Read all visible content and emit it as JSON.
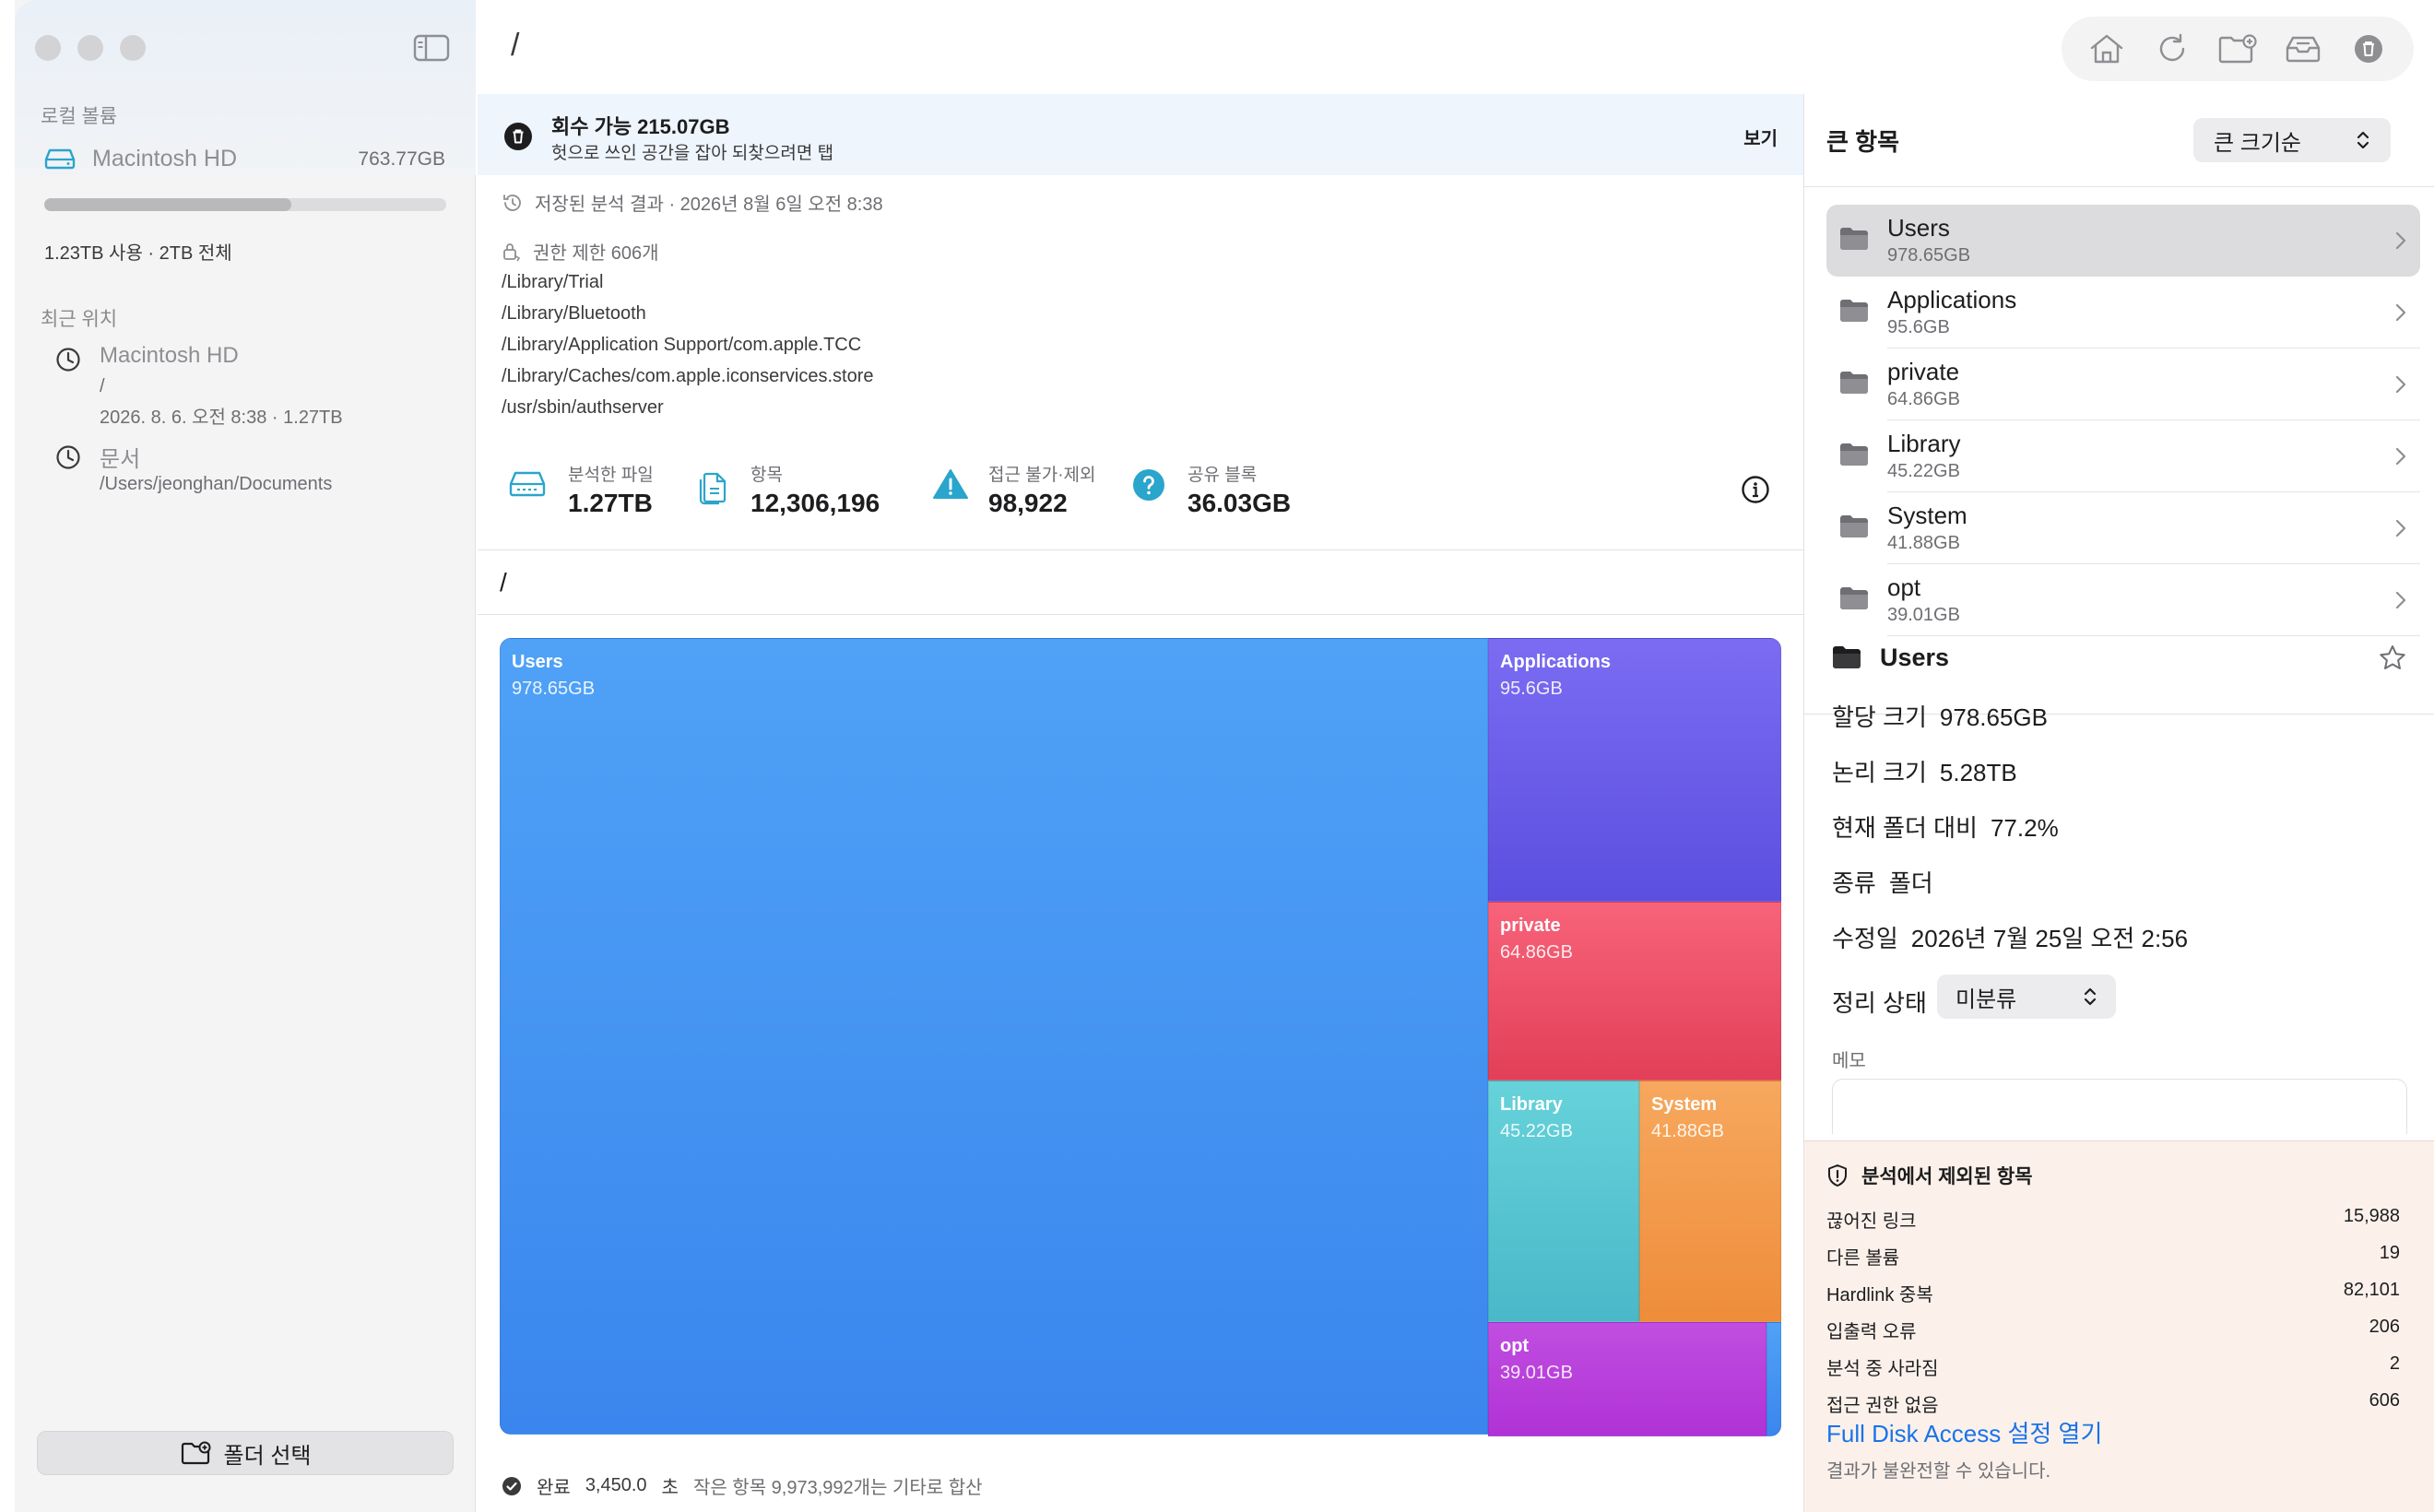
{
  "sidebar": {
    "local_volumes_title": "로컬 볼륨",
    "volume": {
      "name": "Macintosh HD",
      "free": "763.77GB",
      "usage_text": "1.23TB 사용 · 2TB 전체",
      "used_fraction": 0.615
    },
    "recent_title": "최근 위치",
    "recents": [
      {
        "title": "Macintosh HD",
        "line1": "/",
        "line2": "2026. 8. 6. 오전 8:38 · 1.27TB"
      },
      {
        "title": "문서",
        "line1": "/Users/jeonghan/Documents"
      }
    ],
    "folder_button_label": "폴더 선택"
  },
  "topbar": {
    "path": "/",
    "toolbar_icons": [
      "home-icon",
      "refresh-icon",
      "new-folder-icon",
      "archive-icon",
      "trash-icon"
    ]
  },
  "banner": {
    "title": "회수 가능 215.07GB",
    "subtitle": "헛으로 쓰인 공간을 잡아 되찾으려면 탭",
    "action": "보기"
  },
  "saved_result": "저장된 분석 결과 · 2026년 8월 6일 오전 8:38",
  "permissions": {
    "label": "권한 제한 606개",
    "paths": [
      "/Library/Trial",
      "/Library/Bluetooth",
      "/Library/Application Support/com.apple.TCC",
      "/Library/Caches/com.apple.iconservices.store",
      "/usr/sbin/authserver"
    ]
  },
  "stats": [
    {
      "label": "분석한 파일",
      "value": "1.27TB",
      "icon": "disk-icon"
    },
    {
      "label": "항목",
      "value": "12,306,196",
      "icon": "files-icon"
    },
    {
      "label": "접근 불가·제외",
      "value": "98,922",
      "icon": "warning-icon"
    },
    {
      "label": "공유 블록",
      "value": "36.03GB",
      "icon": "question-icon"
    }
  ],
  "current_path": "/",
  "treemap": [
    {
      "name": "Users",
      "size": "978.65GB",
      "color_top": "#4fa2f6",
      "color_bottom": "#3a86ee"
    },
    {
      "name": "Applications",
      "size": "95.6GB",
      "color_top": "#7b6cf2",
      "color_bottom": "#5b4fe0"
    },
    {
      "name": "private",
      "size": "64.86GB",
      "color_top": "#f7637a",
      "color_bottom": "#e23f58"
    },
    {
      "name": "Library",
      "size": "45.22GB",
      "color_top": "#66d2da",
      "color_bottom": "#4ab8c9"
    },
    {
      "name": "System",
      "size": "41.88GB",
      "color_top": "#f7a85e",
      "color_bottom": "#ee8d3a"
    },
    {
      "name": "opt",
      "size": "39.01GB",
      "color_top": "#c14ee0",
      "color_bottom": "#b032d6"
    },
    {
      "name": "",
      "size": "",
      "color_top": "#4fa2f6",
      "color_bottom": "#3a86ee"
    }
  ],
  "status": {
    "label": "완료",
    "seconds": "3,450.0",
    "unit": "초",
    "note": "작은 항목 9,973,992개는 기타로 합산"
  },
  "right_panel": {
    "title": "큰 항목",
    "sort_value": "큰 크기순",
    "big_items": [
      {
        "name": "Users",
        "size": "978.65GB"
      },
      {
        "name": "Applications",
        "size": "95.6GB"
      },
      {
        "name": "private",
        "size": "64.86GB"
      },
      {
        "name": "Library",
        "size": "45.22GB"
      },
      {
        "name": "System",
        "size": "41.88GB"
      },
      {
        "name": "opt",
        "size": "39.01GB"
      }
    ],
    "detail": {
      "name": "Users",
      "rows": [
        {
          "label": "할당 크기",
          "value": "978.65GB"
        },
        {
          "label": "논리 크기",
          "value": "5.28TB"
        },
        {
          "label": "현재 폴더 대비",
          "value": "77.2%"
        },
        {
          "label": "종류",
          "value": "폴더"
        },
        {
          "label": "수정일",
          "value": "2026년 7월 25일 오전 2:56"
        }
      ],
      "status_label": "정리 상태",
      "status_value": "미분류",
      "memo_label": "메모"
    },
    "excluded": {
      "title": "분석에서 제외된 항목",
      "rows": [
        {
          "label": "끊어진 링크",
          "value": "15,988"
        },
        {
          "label": "다른 볼륨",
          "value": "19"
        },
        {
          "label": "Hardlink 중복",
          "value": "82,101"
        },
        {
          "label": "입출력 오류",
          "value": "206"
        },
        {
          "label": "분석 중 사라짐",
          "value": "2"
        },
        {
          "label": "접근 권한 없음",
          "value": "606"
        }
      ],
      "link": "Full Disk Access 설정 열기",
      "note": "결과가 불완전할 수 있습니다."
    }
  },
  "colors": {
    "accent": "#1a73e8",
    "banner_bg": "#eef5fc",
    "excluded_bg": "#fbf1ea"
  }
}
